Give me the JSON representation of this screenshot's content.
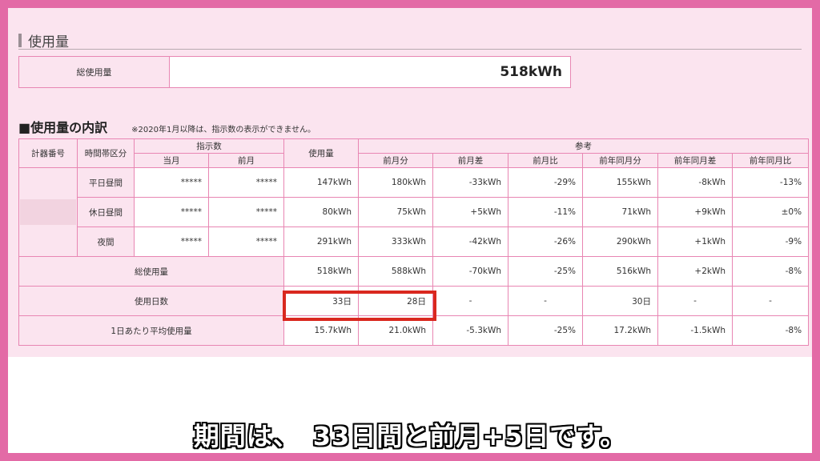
{
  "section_title": "使用量",
  "total": {
    "label": "総使用量",
    "value": "518kWh"
  },
  "breakdown": {
    "title": "■使用量の内訳",
    "note": "※2020年1月以降は、指示数の表示ができません。",
    "headers": {
      "meter_no": "計器番号",
      "time_zone": "時間帯区分",
      "indication": "指示数",
      "current_month": "当月",
      "prev_month": "前月",
      "usage": "使用量",
      "reference": "参考",
      "prev_month_usage": "前月分",
      "prev_month_diff": "前月差",
      "prev_month_ratio": "前月比",
      "prev_year_usage": "前年同月分",
      "prev_year_diff": "前年同月差",
      "prev_year_ratio": "前年同月比"
    },
    "rows": [
      {
        "zone": "平日昼間",
        "cur": "*****",
        "prev": "*****",
        "usage": "147kWh",
        "pm": "180kWh",
        "pmd": "-33kWh",
        "pmr": "-29%",
        "py": "155kWh",
        "pyd": "-8kWh",
        "pyr": "-13%"
      },
      {
        "zone": "休日昼間",
        "cur": "*****",
        "prev": "*****",
        "usage": "80kWh",
        "pm": "75kWh",
        "pmd": "+5kWh",
        "pmr": "-11%",
        "py": "71kWh",
        "pyd": "+9kWh",
        "pyr": "±0%"
      },
      {
        "zone": "夜間",
        "cur": "*****",
        "prev": "*****",
        "usage": "291kWh",
        "pm": "333kWh",
        "pmd": "-42kWh",
        "pmr": "-26%",
        "py": "290kWh",
        "pyd": "+1kWh",
        "pyr": "-9%"
      }
    ],
    "total_row": {
      "label": "総使用量",
      "usage": "518kWh",
      "pm": "588kWh",
      "pmd": "-70kWh",
      "pmr": "-25%",
      "py": "516kWh",
      "pyd": "+2kWh",
      "pyr": "-8%"
    },
    "days_row": {
      "label": "使用日数",
      "usage": "33日",
      "pm": "28日",
      "pmd": "-",
      "pmr": "-",
      "py": "30日",
      "pyd": "-",
      "pyr": "-"
    },
    "avg_row": {
      "label": "1日あたり平均使用量",
      "usage": "15.7kWh",
      "pm": "21.0kWh",
      "pmd": "-5.3kWh",
      "pmr": "-25%",
      "py": "17.2kWh",
      "pyd": "-1.5kWh",
      "pyr": "-8%"
    }
  },
  "caption": "期間は、　33日間と前月+5日です。",
  "colors": {
    "frame": "#e36aa6",
    "panel": "#fbe4ef",
    "border": "#e886b3",
    "highlight": "#d9281f"
  }
}
